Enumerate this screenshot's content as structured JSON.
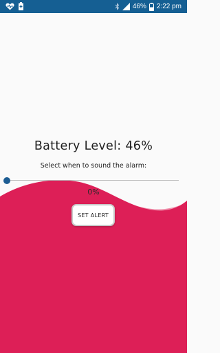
{
  "status_bar": {
    "battery_percent": "46%",
    "time": "2:22 pm",
    "background": "#155f93",
    "left_icons": [
      "heart-notification-icon",
      "battery-saver-icon"
    ],
    "right_icons": [
      "bluetooth-icon",
      "signal-icon",
      "battery-icon"
    ]
  },
  "main": {
    "battery_level_text": "Battery Level: 46%",
    "instruction": "Select when to sound the alarm:",
    "slider": {
      "value_fraction": 0.0,
      "color": "#1d5d93"
    },
    "percent_display": "0%",
    "set_alert_label": "SET ALERT",
    "wave_colors": {
      "main": "#dd1f57",
      "back": "#ef92ad"
    }
  }
}
